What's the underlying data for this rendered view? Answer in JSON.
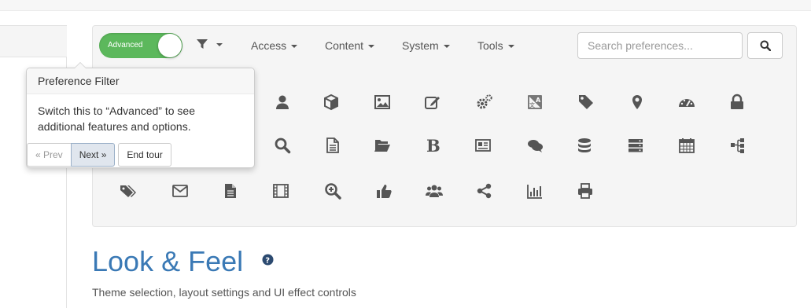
{
  "toggle": {
    "label": "Advanced"
  },
  "menus": {
    "access": "Access",
    "content": "Content",
    "system": "System",
    "tools": "Tools"
  },
  "search": {
    "placeholder": "Search preferences..."
  },
  "tour": {
    "title": "Preference Filter",
    "content": "Switch this to “Advanced” to see additional features and options.",
    "prev": "« Prev",
    "next": "Next »",
    "end": "End tour"
  },
  "section": {
    "title": "Look & Feel",
    "subtitle": "Theme selection, layout settings and UI effect controls"
  },
  "colors": {
    "toggle_on": "#5cb85c",
    "heading": "#3a79b5",
    "icon": "#555555"
  }
}
